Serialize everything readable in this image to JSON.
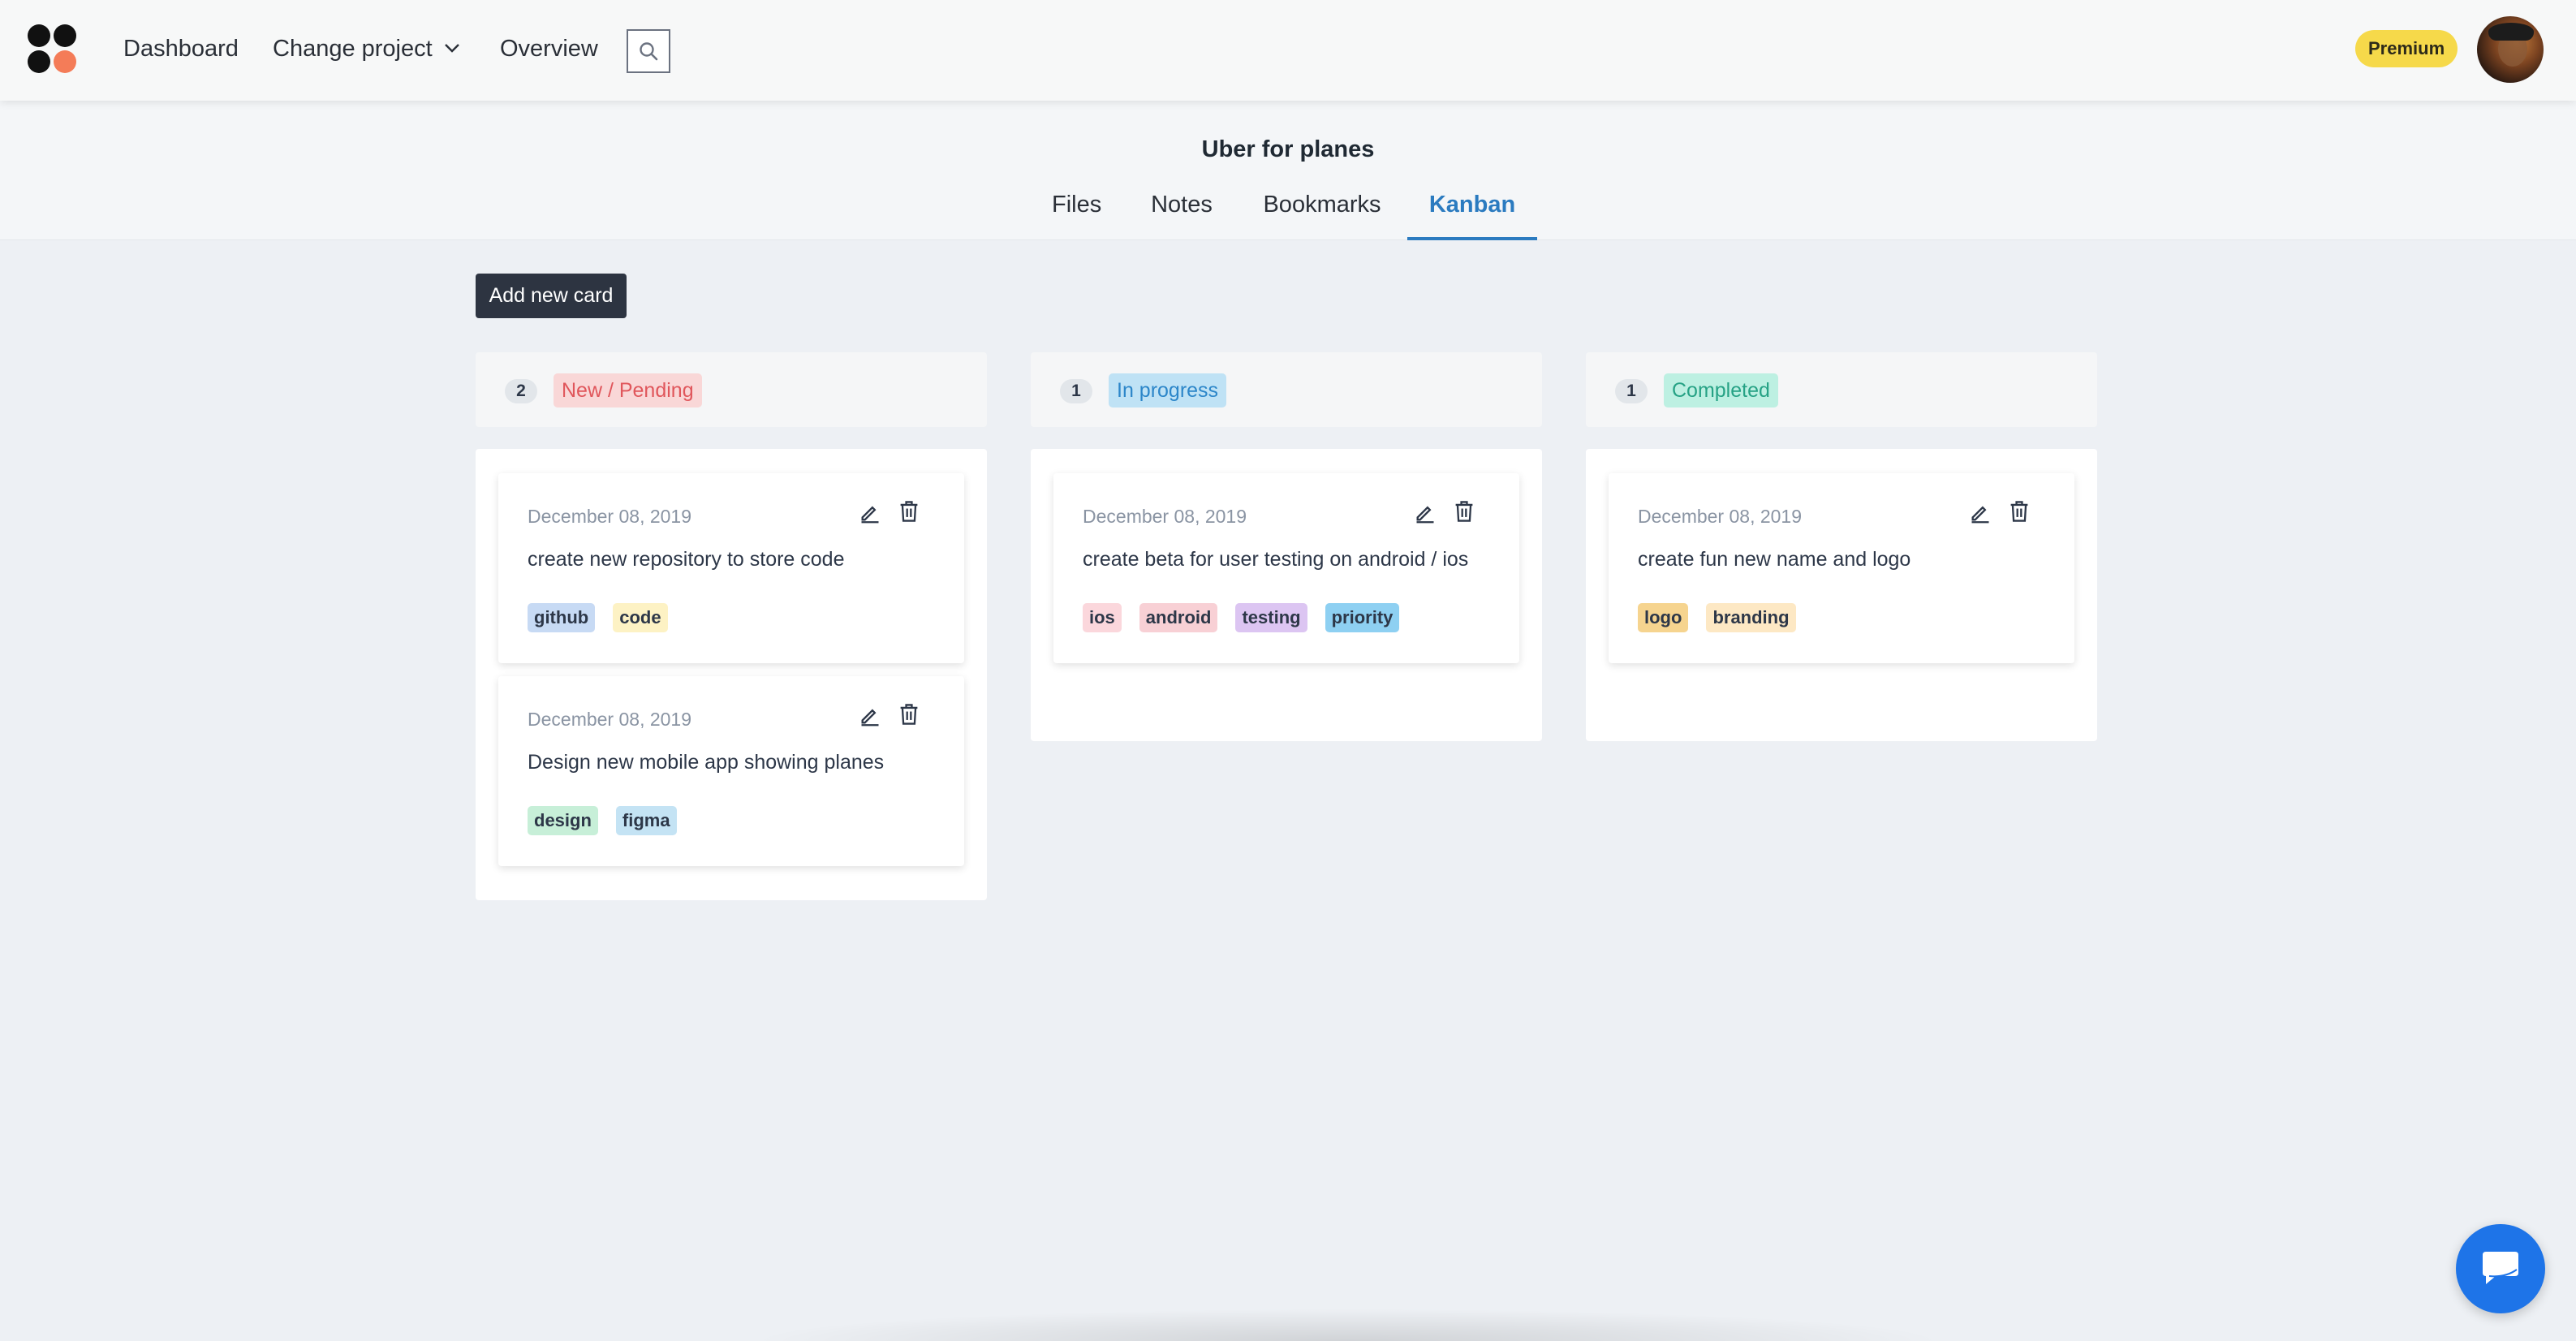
{
  "nav": {
    "dashboard": "Dashboard",
    "change_project": "Change project",
    "overview": "Overview",
    "premium": "Premium"
  },
  "project": {
    "title": "Uber for planes",
    "tabs": [
      "Files",
      "Notes",
      "Bookmarks",
      "Kanban"
    ],
    "active_tab": "Kanban"
  },
  "toolbar": {
    "add_card": "Add new card"
  },
  "columns": [
    {
      "count": "2",
      "status": "New / Pending",
      "cards": [
        {
          "date": "December 08, 2019",
          "title": "create new repository to store code",
          "tags": [
            "github",
            "code"
          ]
        },
        {
          "date": "December 08, 2019",
          "title": "Design new mobile app showing planes",
          "tags": [
            "design",
            "figma"
          ]
        }
      ]
    },
    {
      "count": "1",
      "status": "In progress",
      "cards": [
        {
          "date": "December 08, 2019",
          "title": "create beta for user testing on android / ios",
          "tags": [
            "ios",
            "android",
            "testing",
            "priority"
          ]
        }
      ]
    },
    {
      "count": "1",
      "status": "Completed",
      "cards": [
        {
          "date": "December 08, 2019",
          "title": "create fun new name and logo",
          "tags": [
            "logo",
            "branding"
          ]
        }
      ]
    }
  ],
  "colors": {
    "accent": "#2b7bc0",
    "button_dark": "#2d3441",
    "premium": "#f6d94a",
    "chat": "#1e74e8"
  },
  "icons": [
    "logo-icon",
    "chevron-down-icon",
    "search-icon",
    "edit-icon",
    "trash-icon",
    "chat-icon"
  ]
}
